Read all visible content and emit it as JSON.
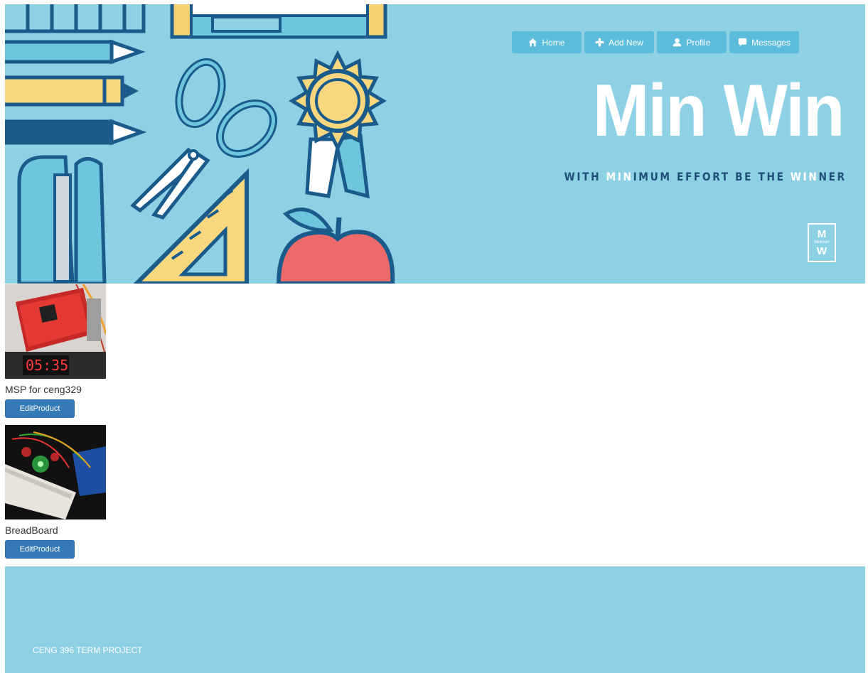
{
  "nav": {
    "items": [
      {
        "label": "Home",
        "icon": "home-icon"
      },
      {
        "label": "Add New",
        "icon": "plus-icon"
      },
      {
        "label": "Profile",
        "icon": "user-icon"
      },
      {
        "label": "Messages",
        "icon": "message-icon"
      }
    ]
  },
  "brand": {
    "title": "Min Win",
    "tagline_parts": [
      "WITH ",
      "MIN",
      "IMUM EFFORT BE THE ",
      "WIN",
      "NER"
    ],
    "logo_top": "M",
    "logo_small": "Minimum",
    "logo_bottom": "W"
  },
  "products": [
    {
      "name": "MSP for ceng329",
      "button": "EditProduct"
    },
    {
      "name": "BreadBoard",
      "button": "EditProduct"
    }
  ],
  "footer": {
    "text": "CENG 396 TERM PROJECT"
  },
  "colors": {
    "banner": "#8fd1e4",
    "nav_button": "#5cbcdc",
    "primary_button": "#337ab7",
    "tagline": "#1f4e79"
  }
}
